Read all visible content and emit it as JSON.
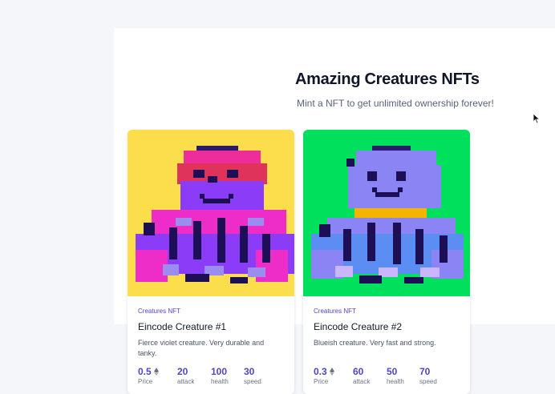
{
  "header": {
    "title": "Amazing Creatures NFTs",
    "subtitle": "Mint a NFT to get unlimited ownership forever!"
  },
  "cards": [
    {
      "image_icon": "pixel-octopus-violet",
      "background_color": "#fcdd4c",
      "category": "Creatures NFT",
      "name": "Eincode Creature #1",
      "description": "Fierce violet creature. Very durable and tanky.",
      "stats": [
        {
          "value": "0.5",
          "label": "Price"
        },
        {
          "value": "20",
          "label": "attack"
        },
        {
          "value": "100",
          "label": "health"
        },
        {
          "value": "30",
          "label": "speed"
        }
      ]
    },
    {
      "image_icon": "pixel-octopus-blue",
      "background_color": "#00e05d",
      "category": "Creatures NFT",
      "name": "Eincode Creature #2",
      "description": "Blueish creature. Very fast and strong.",
      "stats": [
        {
          "value": "0.3",
          "label": "Price"
        },
        {
          "value": "60",
          "label": "attack"
        },
        {
          "value": "50",
          "label": "health"
        },
        {
          "value": "70",
          "label": "speed"
        }
      ]
    }
  ]
}
